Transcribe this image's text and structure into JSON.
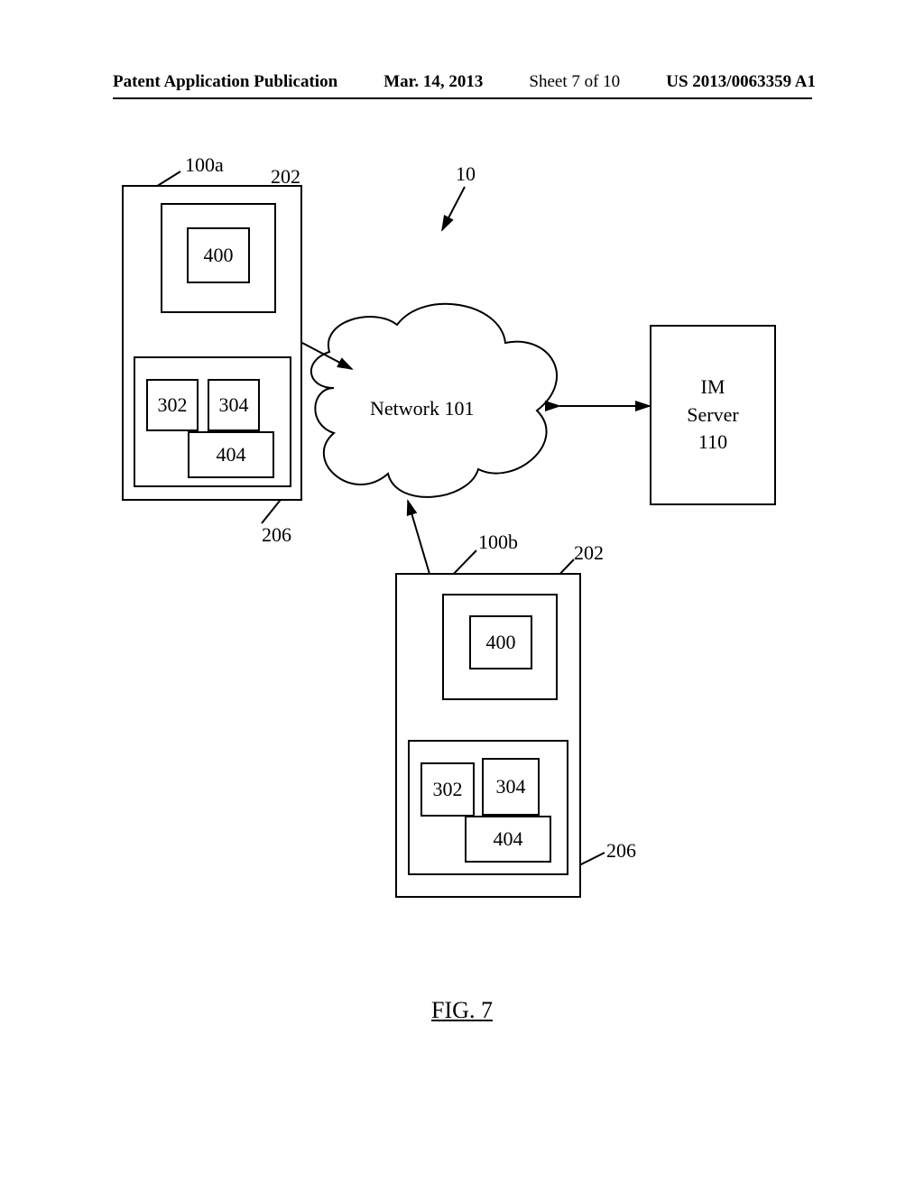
{
  "header": {
    "pub_type": "Patent Application Publication",
    "date": "Mar. 14, 2013",
    "sheet": "Sheet 7 of 10",
    "pub_number": "US 2013/0063359 A1"
  },
  "figure_caption": "FIG. 7",
  "cloud": {
    "label": "Network 101"
  },
  "im_server": {
    "line1": "IM",
    "line2": "Server",
    "line3": "110"
  },
  "labels": {
    "ref_10": "10",
    "device_a": {
      "ref_100a": "100a",
      "ref_202": "202",
      "ref_206": "206",
      "box_400": "400",
      "box_302": "302",
      "box_304": "304",
      "box_404": "404"
    },
    "device_b": {
      "ref_100b": "100b",
      "ref_202": "202",
      "ref_206": "206",
      "box_400": "400",
      "box_302": "302",
      "box_304": "304",
      "box_404": "404"
    }
  }
}
